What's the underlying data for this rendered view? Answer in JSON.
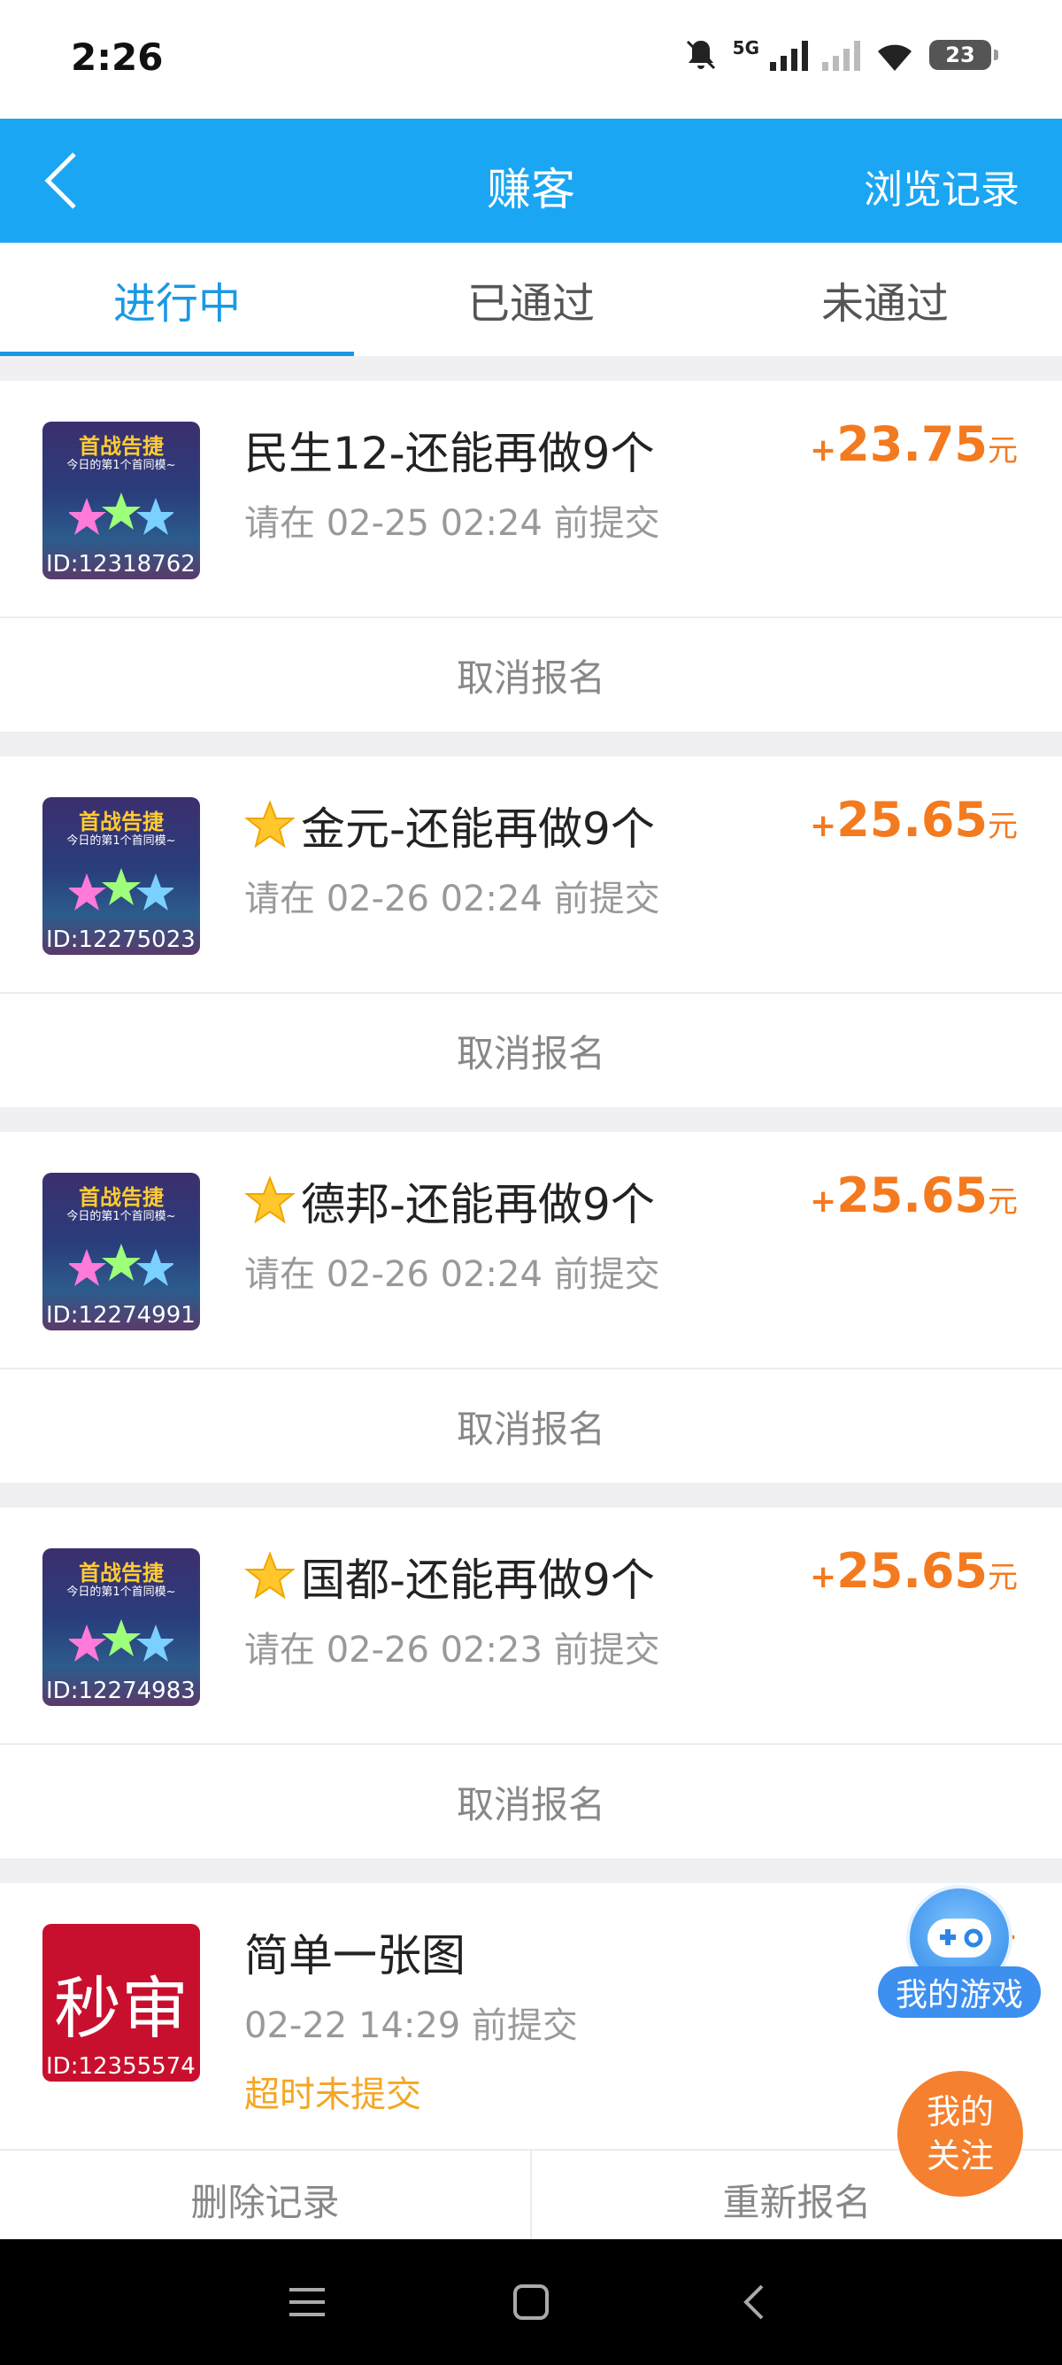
{
  "status_bar": {
    "time": "2:26",
    "network": "5G",
    "battery": "23"
  },
  "header": {
    "title": "赚客",
    "right_link": "浏览记录"
  },
  "tabs": [
    {
      "label": "进行中",
      "active": true
    },
    {
      "label": "已通过",
      "active": false
    },
    {
      "label": "未通过",
      "active": false
    }
  ],
  "thumb_banner": {
    "title": "首战告捷",
    "subtitle": "今日的第1个首同模~"
  },
  "tasks": [
    {
      "title": "民生12-还能再做9个",
      "starred": false,
      "deadline": "请在 02-25 02:24 前提交",
      "plus": "+",
      "amount": "23.75",
      "unit": "元",
      "thumb_id": "ID:12318762",
      "action": "取消报名"
    },
    {
      "title": "金元-还能再做9个",
      "starred": true,
      "deadline": "请在 02-26 02:24 前提交",
      "plus": "+",
      "amount": "25.65",
      "unit": "元",
      "thumb_id": "ID:12275023",
      "action": "取消报名"
    },
    {
      "title": "德邦-还能再做9个",
      "starred": true,
      "deadline": "请在 02-26 02:24 前提交",
      "plus": "+",
      "amount": "25.65",
      "unit": "元",
      "thumb_id": "ID:12274991",
      "action": "取消报名"
    },
    {
      "title": "国都-还能再做9个",
      "starred": true,
      "deadline": "请在 02-26 02:23 前提交",
      "plus": "+",
      "amount": "25.65",
      "unit": "元",
      "thumb_id": "ID:12274983",
      "action": "取消报名"
    }
  ],
  "expired_task": {
    "title": "简单一张图",
    "deadline": "02-22 14:29 前提交",
    "status": "超时未提交",
    "plus": "+",
    "thumb_text": "秒审",
    "thumb_id": "ID:12355574",
    "actions": [
      "删除记录",
      "重新报名"
    ]
  },
  "floating": {
    "my_games": "我的游戏",
    "my_follow": "我的关注"
  },
  "colors": {
    "header": "#1aa6f2",
    "active_tab": "#1a98e6",
    "reward": "#f47a1f",
    "expired": "#f5a623"
  }
}
